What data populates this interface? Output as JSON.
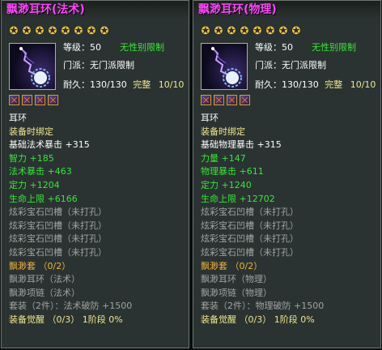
{
  "panels": [
    {
      "title": "飘渺耳环(法术)",
      "level_label": "等级：",
      "level_value": "50",
      "gender": "无性别限制",
      "sect": "门派：无门派限制",
      "durability_label": "耐久：",
      "durability_value": "130/130",
      "condition": "完整",
      "condition_value": "10/10",
      "lines": [
        {
          "text": "耳环",
          "color": "w"
        },
        {
          "text": "装备时绑定",
          "color": "y"
        },
        {
          "text": "基础法术暴击 +315",
          "color": "w"
        },
        {
          "text": "智力 +185",
          "color": "g"
        },
        {
          "text": "法术暴击 +463",
          "color": "g"
        },
        {
          "text": "定力 +1204",
          "color": "g"
        },
        {
          "text": "生命上限 +6166",
          "color": "g"
        },
        {
          "text": "炫彩宝石凹槽（未打孔）",
          "color": "gr"
        },
        {
          "text": "炫彩宝石凹槽（未打孔）",
          "color": "gr"
        },
        {
          "text": "炫彩宝石凹槽（未打孔）",
          "color": "gr"
        },
        {
          "text": "炫彩宝石凹槽（未打孔）",
          "color": "gr"
        },
        {
          "text": "飘渺套 （0/2）",
          "color": "o"
        },
        {
          "text": "飘渺耳环（法术）",
          "color": "gr"
        },
        {
          "text": "飘渺项链（法术）",
          "color": "gr"
        },
        {
          "text": "套装（2件）：法术破防 +1500",
          "color": "gr"
        },
        {
          "text": "装备觉醒 （0/3） 1阶段 0%",
          "color": "y"
        }
      ]
    },
    {
      "title": "飘渺耳环(物理)",
      "level_label": "等级：",
      "level_value": "50",
      "gender": "无性别限制",
      "sect": "门派：无门派限制",
      "durability_label": "耐久：",
      "durability_value": "130/130",
      "condition": "完整",
      "condition_value": "10/10",
      "lines": [
        {
          "text": "耳环",
          "color": "w"
        },
        {
          "text": "装备时绑定",
          "color": "y"
        },
        {
          "text": "基础物理暴击 +315",
          "color": "w"
        },
        {
          "text": "力量 +147",
          "color": "g"
        },
        {
          "text": "物理暴击 +611",
          "color": "g"
        },
        {
          "text": "定力 +1240",
          "color": "g"
        },
        {
          "text": "生命上限 +12702",
          "color": "g"
        },
        {
          "text": "炫彩宝石凹槽（未打孔）",
          "color": "gr"
        },
        {
          "text": "炫彩宝石凹槽（未打孔）",
          "color": "gr"
        },
        {
          "text": "炫彩宝石凹槽（未打孔）",
          "color": "gr"
        },
        {
          "text": "炫彩宝石凹槽（未打孔）",
          "color": "gr"
        },
        {
          "text": "飘渺套 （0/2）",
          "color": "o"
        },
        {
          "text": "飘渺耳环（物理）",
          "color": "gr"
        },
        {
          "text": "飘渺项链（物理）",
          "color": "gr"
        },
        {
          "text": "套装（2件）：物理破防 +1500",
          "color": "gr"
        },
        {
          "text": "装备觉醒 （0/3） 1阶段 0%",
          "color": "y"
        }
      ]
    }
  ],
  "star_count": 8,
  "socket_count": 4,
  "colors": {
    "title": "#ff44ff",
    "green": "#37e737",
    "yellow": "#f0e78e",
    "gray": "#a0a4a2",
    "orange": "#f2b33c"
  }
}
